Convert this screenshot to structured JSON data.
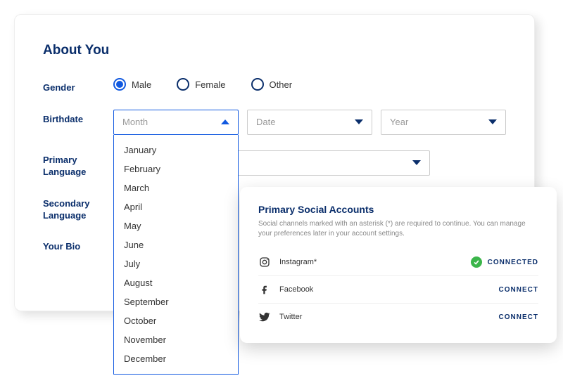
{
  "section_title": "About You",
  "gender": {
    "label": "Gender",
    "options": {
      "male": "Male",
      "female": "Female",
      "other": "Other"
    }
  },
  "birthdate": {
    "label": "Birthdate",
    "month_placeholder": "Month",
    "date_placeholder": "Date",
    "year_placeholder": "Year",
    "months": [
      "January",
      "February",
      "March",
      "April",
      "May",
      "June",
      "July",
      "August",
      "September",
      "October",
      "November",
      "December"
    ]
  },
  "primary_language": {
    "label": "Primary Language"
  },
  "secondary_language": {
    "label": "Secondary Language"
  },
  "your_bio": {
    "label": "Your Bio"
  },
  "social": {
    "title": "Primary Social Accounts",
    "description": "Social channels marked with an asterisk (*) are required to continue. You can manage your preferences later in your account settings.",
    "accounts": {
      "instagram": {
        "name": "Instagram*",
        "status": "CONNECTED"
      },
      "facebook": {
        "name": "Facebook",
        "status": "CONNECT"
      },
      "twitter": {
        "name": "Twitter",
        "status": "CONNECT"
      }
    }
  }
}
